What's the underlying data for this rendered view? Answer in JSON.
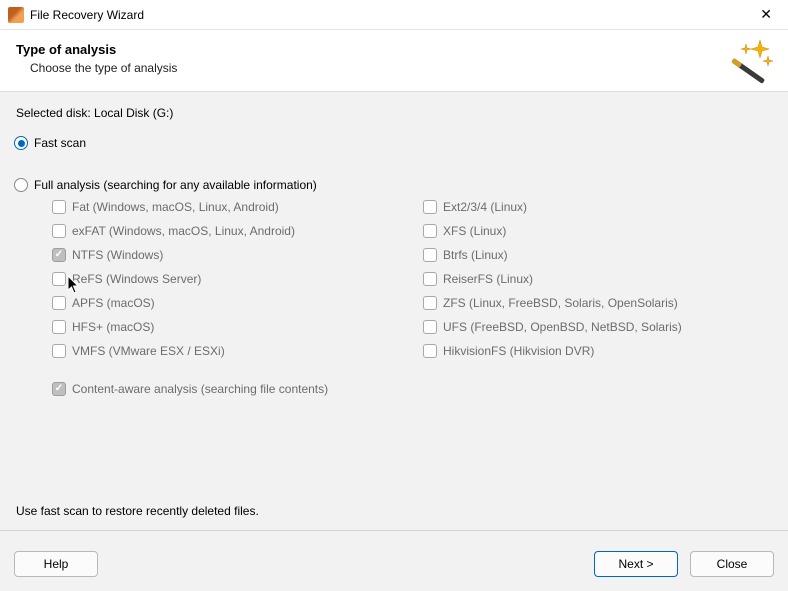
{
  "titlebar": {
    "title": "File Recovery Wizard",
    "close": "✕"
  },
  "header": {
    "title": "Type of analysis",
    "subtitle": "Choose the type of analysis"
  },
  "body": {
    "selected_disk_label": "Selected disk: Local Disk (G:)",
    "options": {
      "fast": {
        "label": "Fast scan",
        "selected": true
      },
      "full": {
        "label": "Full analysis (searching for any available information)",
        "selected": false
      }
    },
    "filesystems_left": [
      {
        "label": "Fat (Windows, macOS, Linux, Android)",
        "checked": false
      },
      {
        "label": "exFAT (Windows, macOS, Linux, Android)",
        "checked": false
      },
      {
        "label": "NTFS (Windows)",
        "checked": true
      },
      {
        "label": "ReFS (Windows Server)",
        "checked": false
      },
      {
        "label": "APFS (macOS)",
        "checked": false
      },
      {
        "label": "HFS+ (macOS)",
        "checked": false
      },
      {
        "label": "VMFS (VMware ESX / ESXi)",
        "checked": false
      }
    ],
    "filesystems_right": [
      {
        "label": "Ext2/3/4 (Linux)",
        "checked": false
      },
      {
        "label": "XFS (Linux)",
        "checked": false
      },
      {
        "label": "Btrfs (Linux)",
        "checked": false
      },
      {
        "label": "ReiserFS (Linux)",
        "checked": false
      },
      {
        "label": "ZFS (Linux, FreeBSD, Solaris, OpenSolaris)",
        "checked": false
      },
      {
        "label": "UFS (FreeBSD, OpenBSD, NetBSD, Solaris)",
        "checked": false
      },
      {
        "label": "HikvisionFS (Hikvision DVR)",
        "checked": false
      }
    ],
    "content_aware": {
      "label": "Content-aware analysis (searching file contents)",
      "checked": true
    },
    "hint": "Use fast scan to restore recently deleted files."
  },
  "footer": {
    "help": "Help",
    "next": "Next >",
    "close": "Close"
  }
}
